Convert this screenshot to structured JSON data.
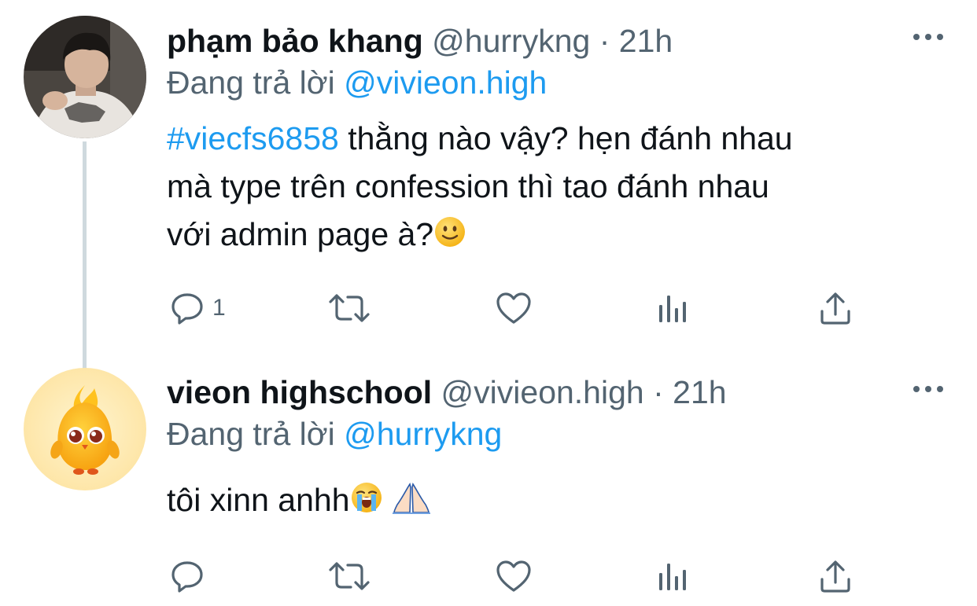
{
  "tweets": [
    {
      "name": "phạm bảo khang",
      "handle": "@hurrykng",
      "dot": "·",
      "time": "21h",
      "reply_prefix": "Đang trả lời",
      "reply_to": "@vivieon.high",
      "hashtag": "#viecfs6858",
      "line1_rest": " thằng nào vậy? hẹn đánh nhau",
      "line2": "mà type trên confession thì tao đánh nhau",
      "line3": "với admin page à?",
      "reply_count": "1",
      "icons": [
        "reply-icon",
        "retweet-icon",
        "like-icon",
        "analytics-icon",
        "share-icon"
      ]
    },
    {
      "name": "vieon highschool",
      "handle": "@vivieon.high",
      "dot": "·",
      "time": "21h",
      "reply_prefix": "Đang trả lời",
      "reply_to": "@hurrykng",
      "line1": "tôi xinn anhh",
      "reply_count": "",
      "icons": [
        "reply-icon",
        "retweet-icon",
        "like-icon",
        "analytics-icon",
        "share-icon"
      ]
    }
  ],
  "colors": {
    "accent": "#1d9bf0",
    "secondary_text": "#536471",
    "primary_text": "#0f1419",
    "thread_line": "#cfd9de"
  }
}
